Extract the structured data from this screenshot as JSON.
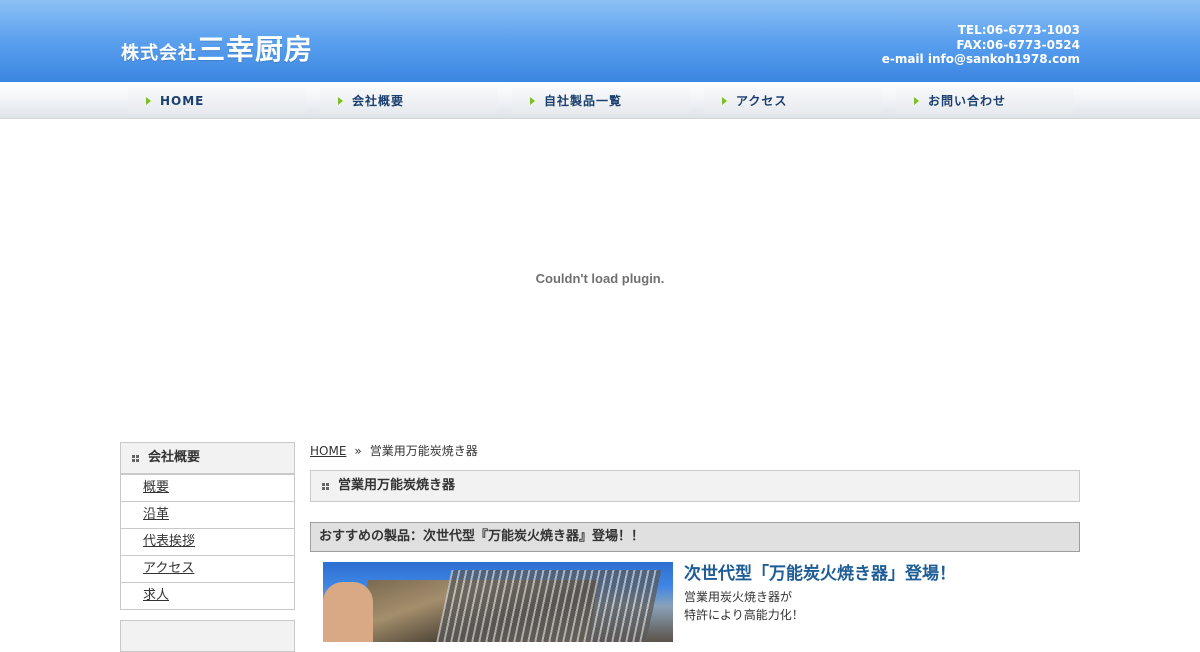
{
  "header": {
    "logo_prefix": "株式会社",
    "logo_name": "三幸厨房",
    "tel": "TEL:06-6773-1003",
    "fax": "FAX:06-6773-0524",
    "email": "e-mail info@sankoh1978.com"
  },
  "nav": {
    "items": [
      {
        "label": "HOME"
      },
      {
        "label": "会社概要"
      },
      {
        "label": "自社製品一覧"
      },
      {
        "label": "アクセス"
      },
      {
        "label": "お問い合わせ"
      }
    ]
  },
  "plugin": {
    "message": "Couldn't load plugin."
  },
  "sidebar": {
    "heading": "会社概要",
    "items": [
      {
        "label": "概要"
      },
      {
        "label": "沿革"
      },
      {
        "label": "代表挨拶"
      },
      {
        "label": "アクセス"
      },
      {
        "label": "求人"
      }
    ]
  },
  "breadcrumb": {
    "home": "HOME",
    "separator": "»",
    "current": "営業用万能炭焼き器"
  },
  "main": {
    "page_title": "営業用万能炭焼き器",
    "section_heading": "おすすめの製品：次世代型『万能炭火焼き器』登場！！",
    "product_title": "次世代型「万能炭火焼き器」登場！",
    "product_desc_line1": "営業用炭火焼き器が",
    "product_desc_line2": "特許により高能力化！"
  },
  "colors": {
    "header_blue": "#3b86e2",
    "nav_text": "#1b3f6e",
    "nav_arrow": "#7bbf2a",
    "product_title": "#1f5d96"
  }
}
